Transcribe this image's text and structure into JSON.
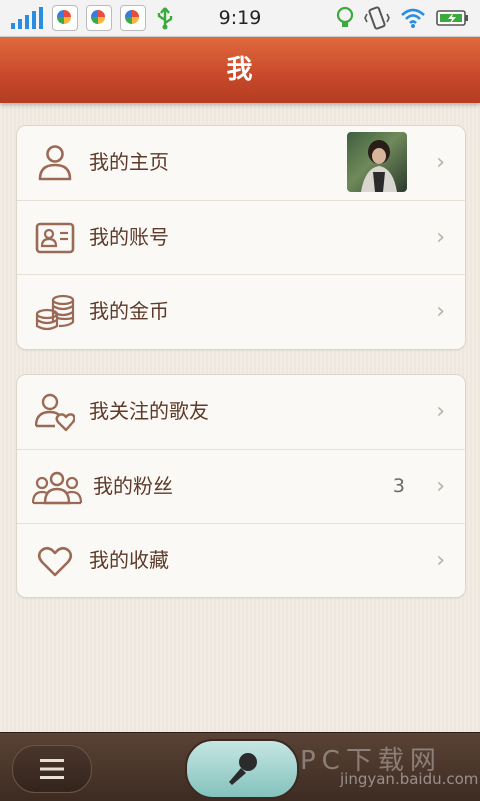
{
  "status_bar": {
    "time": "9:19",
    "icons": [
      "signal-icon",
      "app-notification-icon",
      "app-notification-icon",
      "app-notification-icon",
      "usb-icon",
      "lightbulb-icon",
      "vibrate-icon",
      "wifi-icon",
      "battery-icon"
    ]
  },
  "header": {
    "title": "我"
  },
  "sections": [
    {
      "items": [
        {
          "label": "我的主页",
          "icon": "person-icon",
          "has_avatar": true
        },
        {
          "label": "我的账号",
          "icon": "id-card-icon"
        },
        {
          "label": "我的金币",
          "icon": "coins-icon"
        }
      ]
    },
    {
      "items": [
        {
          "label": "我关注的歌友",
          "icon": "person-heart-icon"
        },
        {
          "label": "我的粉丝",
          "icon": "group-icon",
          "count": "3"
        },
        {
          "label": "我的收藏",
          "icon": "heart-icon"
        }
      ]
    }
  ],
  "bottom_bar": {
    "menu_icon": "menu-icon",
    "mic_icon": "microphone-icon"
  },
  "watermark": {
    "text": "PC下载网",
    "sub": "jingyan.baidu.com"
  },
  "colors": {
    "accent": "#c7482a",
    "icon": "#9b6a57",
    "text": "#5d3a2a"
  }
}
